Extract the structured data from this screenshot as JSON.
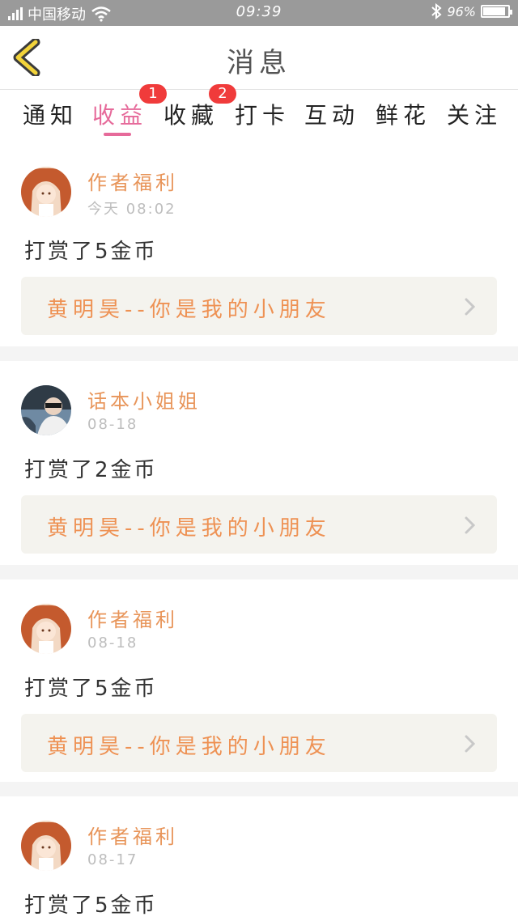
{
  "status_bar": {
    "carrier": "中国移动",
    "time": "09:39",
    "battery": "96%",
    "battery_level": 0.96,
    "icons": [
      "signal-icon",
      "wifi-icon",
      "bluetooth-icon",
      "battery-icon"
    ]
  },
  "header": {
    "title": "消息",
    "back_icon": "back-chevron-icon"
  },
  "tabs": [
    {
      "label": "通知",
      "active": false
    },
    {
      "label": "收益",
      "active": true,
      "badge": "1"
    },
    {
      "label": "收藏",
      "active": false,
      "badge": "2"
    },
    {
      "label": "打卡",
      "active": false
    },
    {
      "label": "互动",
      "active": false
    },
    {
      "label": "鲜花",
      "active": false
    },
    {
      "label": "关注",
      "active": false
    }
  ],
  "colors": {
    "accent": "#e66a9a",
    "sender": "#e8955a",
    "quote_text": "#ee9153",
    "badge": "#f03b3b",
    "status_bar": "#9a9a9a",
    "quote_bg": "#f4f3ee"
  },
  "messages": [
    {
      "sender": "作者福利",
      "time": "今天 08:02",
      "text": "打赏了5金币",
      "quote": "黄明昊--你是我的小朋友",
      "avatar": "avatar-girl"
    },
    {
      "sender": "话本小姐姐",
      "time": "08-18",
      "text": "打赏了2金币",
      "quote": "黄明昊--你是我的小朋友",
      "avatar": "avatar-boy"
    },
    {
      "sender": "作者福利",
      "time": "08-18",
      "text": "打赏了5金币",
      "quote": "黄明昊--你是我的小朋友",
      "avatar": "avatar-girl"
    },
    {
      "sender": "作者福利",
      "time": "08-17",
      "text": "打赏了5金币",
      "quote": "",
      "avatar": "avatar-girl"
    }
  ]
}
